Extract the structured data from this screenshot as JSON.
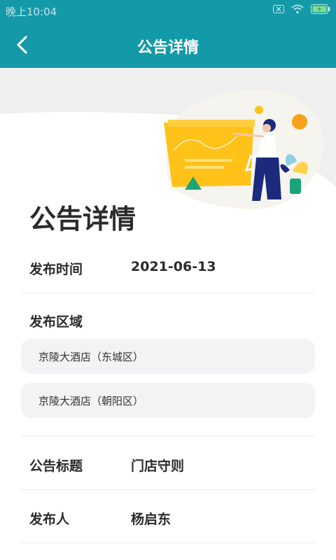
{
  "status_bar": {
    "time": "晚上10:04",
    "icons": [
      "sim-off-icon",
      "wifi-icon",
      "battery-charging-icon"
    ]
  },
  "header": {
    "title": "公告详情",
    "back_icon": "chevron-left-icon"
  },
  "page": {
    "heading": "公告详情"
  },
  "details": {
    "publish_time_label": "发布时间",
    "publish_time_value": "2021-06-13",
    "region_label": "发布区域",
    "regions": [
      "京陵大酒店（东城区）",
      "京陵大酒店（朝阳区）"
    ],
    "notice_title_label": "公告标题",
    "notice_title_value": "门店守则",
    "publisher_label": "发布人",
    "publisher_value": "杨启东"
  },
  "colors": {
    "header_bg": "#1499a8",
    "illustration_yellow": "#ffc219",
    "illustration_navy": "#1c2a7d",
    "illustration_orange": "#f7a21b"
  }
}
